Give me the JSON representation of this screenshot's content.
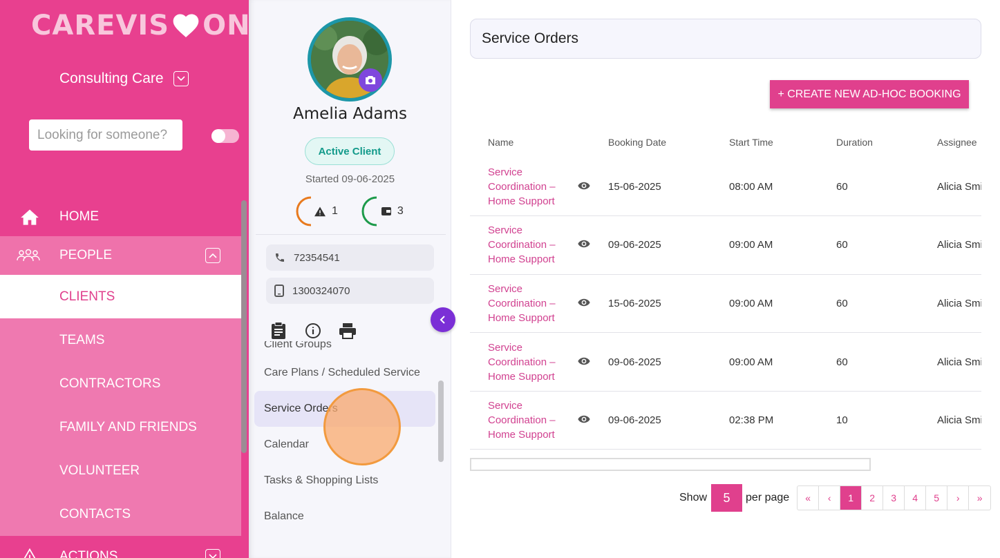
{
  "brand": {
    "logo_left": "CAREVIS",
    "logo_right": "ON"
  },
  "org": {
    "name": "Consulting Care"
  },
  "search": {
    "placeholder": "Looking for someone?"
  },
  "nav": {
    "home": "HOME",
    "people": "PEOPLE",
    "people_sub": [
      "CLIENTS",
      "TEAMS",
      "CONTRACTORS",
      "FAMILY AND FRIENDS",
      "VOLUNTEER",
      "CONTACTS"
    ],
    "actions": "ACTIONS"
  },
  "client": {
    "name": "Amelia Adams",
    "status": "Active Client",
    "started": "Started 09-06-2025",
    "alerts_count": "1",
    "wallet_count": "3",
    "phone": "72354541",
    "mobile": "1300324070"
  },
  "client_menu": [
    "Client Groups",
    "Care Plans / Scheduled Service",
    "Service Orders",
    "Calendar",
    "Tasks & Shopping Lists",
    "Balance"
  ],
  "main": {
    "title": "Service Orders",
    "create_button": "+ CREATE NEW AD-HOC BOOKING",
    "table": {
      "headers": [
        "Name",
        "Booking Date",
        "Start Time",
        "Duration",
        "Assignee"
      ],
      "rows": [
        {
          "name": "Service Coordination – Home Support",
          "date": "15-06-2025",
          "time": "08:00 AM",
          "duration": "60",
          "assignee": "Alicia Smi"
        },
        {
          "name": "Service Coordination – Home Support",
          "date": "09-06-2025",
          "time": "09:00 AM",
          "duration": "60",
          "assignee": "Alicia Smi"
        },
        {
          "name": "Service Coordination – Home Support",
          "date": "15-06-2025",
          "time": "09:00 AM",
          "duration": "60",
          "assignee": "Alicia Smi"
        },
        {
          "name": "Service Coordination – Home Support",
          "date": "09-06-2025",
          "time": "09:00 AM",
          "duration": "60",
          "assignee": "Alicia Smi"
        },
        {
          "name": "Service Coordination – Home Support",
          "date": "09-06-2025",
          "time": "02:38 PM",
          "duration": "10",
          "assignee": "Alicia Smi"
        }
      ]
    },
    "pagination": {
      "show_label": "Show",
      "per_page_value": "5",
      "per_page_label": "per page",
      "first": "«",
      "prev": "‹",
      "pages": [
        "1",
        "2",
        "3",
        "4",
        "5"
      ],
      "current": "1",
      "next": "›",
      "last": "»"
    }
  },
  "colors": {
    "accent": "#e8408f",
    "link": "#d14190",
    "purple": "#7b2fd6",
    "teal": "#1d97a8"
  }
}
